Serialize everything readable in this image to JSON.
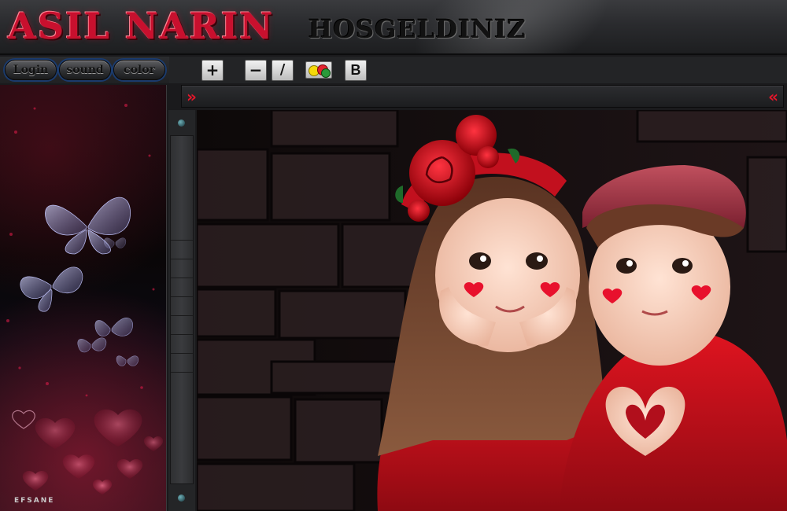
{
  "header": {
    "brand": "ASIL NARIN",
    "welcome": "HOSGELDINIZ"
  },
  "nav": {
    "items": [
      {
        "label": "Login"
      },
      {
        "label": "sound"
      },
      {
        "label": "color"
      }
    ]
  },
  "toolbar": {
    "zoom_in": "+",
    "zoom_out": "−",
    "slash": "/",
    "bold": "B"
  },
  "message_bar": {
    "left_arrow": "»",
    "right_arrow": "«"
  },
  "sidepanel": {
    "signature": "EFSANE"
  },
  "colors": {
    "brand_red": "#c8102e",
    "arrow_red": "#e2162a",
    "nav_glow": "#1b3b6d"
  },
  "icons": [
    "plus-icon",
    "minus-icon",
    "slash-icon",
    "smileys-icon",
    "bold-icon",
    "butterfly-icon",
    "heart-icon"
  ]
}
